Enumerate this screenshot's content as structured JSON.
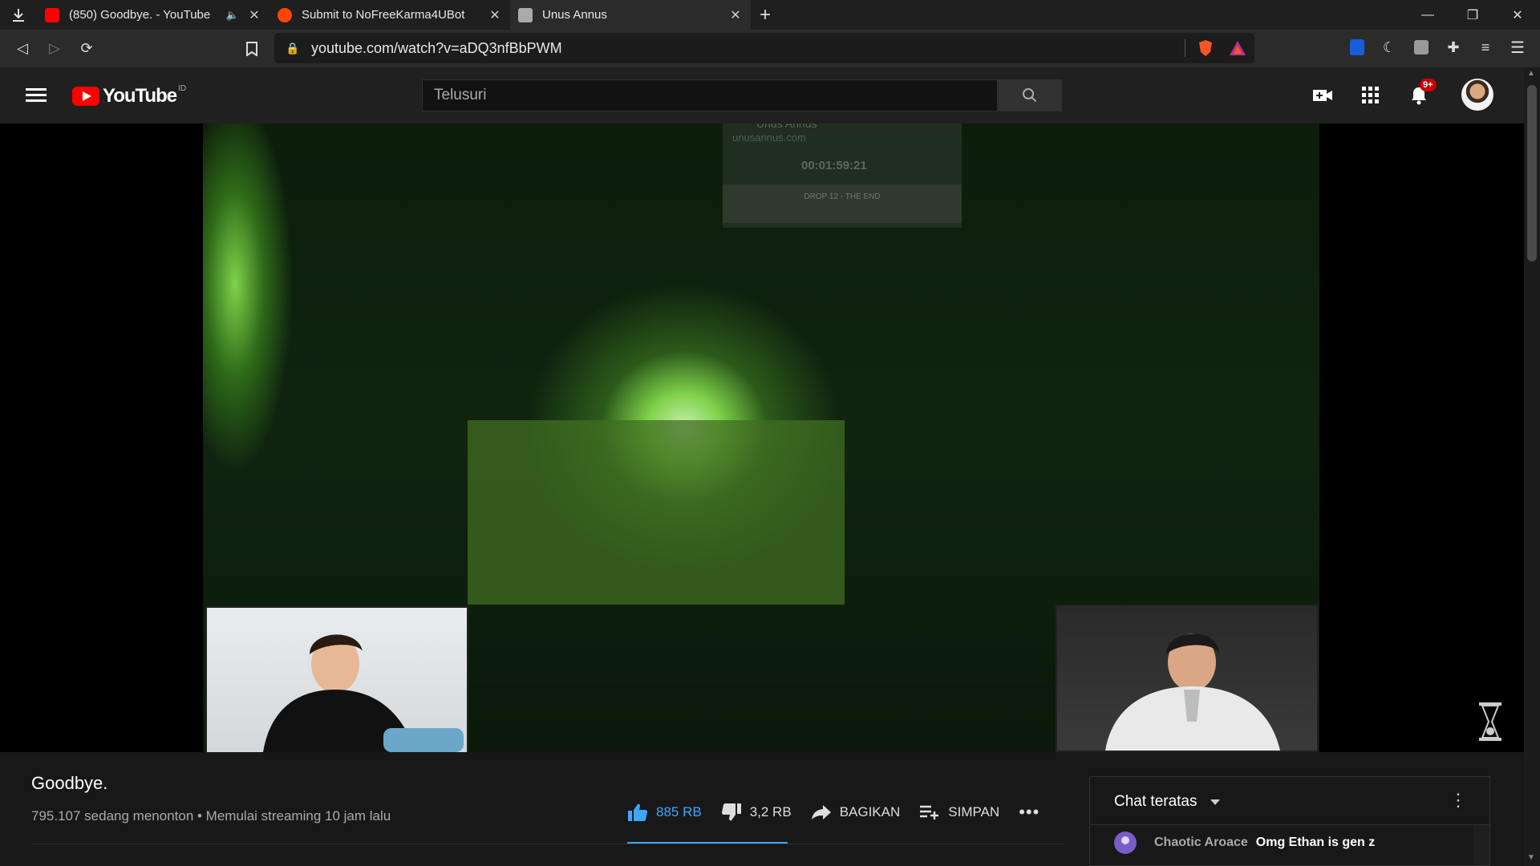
{
  "browser": {
    "tabs": [
      {
        "title": "(850) Goodbye. - YouTube",
        "active": false,
        "muted_icon": "speaker-icon"
      },
      {
        "title": "Submit to NoFreeKarma4UBot",
        "active": false
      },
      {
        "title": "Unus Annus",
        "active": true
      }
    ],
    "url": "youtube.com/watch?v=aDQ3nfBbPWM"
  },
  "youtube": {
    "logo_text": "YouTube",
    "country_code": "ID",
    "search_placeholder": "Telusuri",
    "notification_count": "9+"
  },
  "overlay": {
    "title": "Unus Annus",
    "domain": "unusannus.com",
    "timer": "00:01:59:21",
    "drop_label": "DROP 12 - THE END"
  },
  "video": {
    "title": "Goodbye.",
    "meta": "795.107 sedang menonton • Memulai streaming 10 jam lalu",
    "likes": "885 RB",
    "dislikes": "3,2 RB",
    "share_label": "BAGIKAN",
    "save_label": "SIMPAN"
  },
  "chat": {
    "header": "Chat teratas",
    "messages": [
      {
        "author": "Chaotic Aroace",
        "text": "Omg Ethan is gen z"
      }
    ]
  },
  "colors": {
    "accent_blue": "#3ea6ff",
    "yt_red": "#ff0000",
    "badge_red": "#cc0000"
  }
}
